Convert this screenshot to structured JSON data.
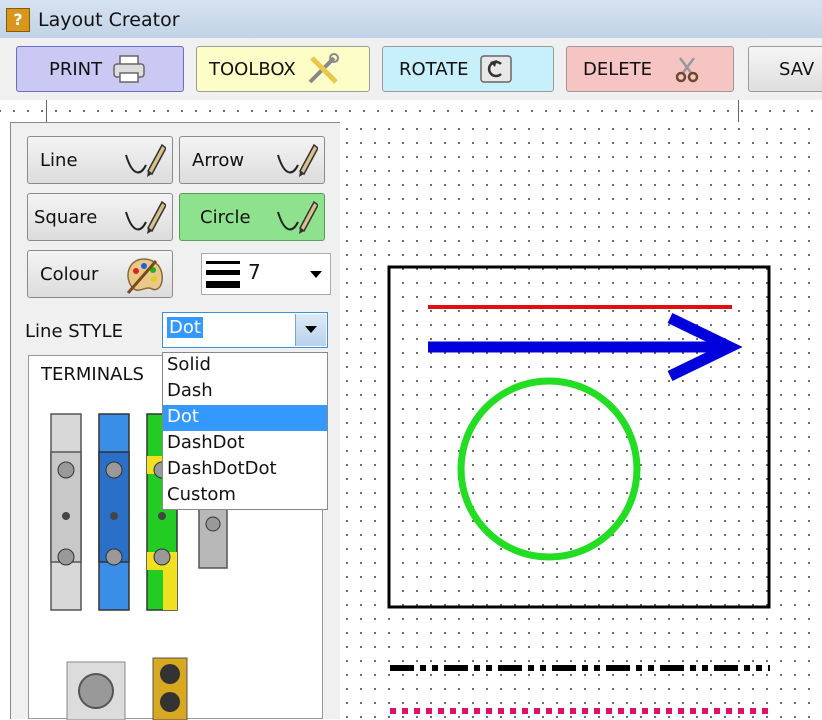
{
  "window": {
    "title": "Layout Creator"
  },
  "toolbar": {
    "print": "PRINT",
    "toolbox": "TOOLBOX",
    "rotate": "ROTATE",
    "delete": "DELETE",
    "save": "SAV"
  },
  "tools": {
    "line": "Line",
    "arrow": "Arrow",
    "square": "Square",
    "circle": "Circle",
    "colour": "Colour",
    "thickness_value": "7"
  },
  "line_style": {
    "label": "Line STYLE",
    "selected": "Dot",
    "options": [
      "Solid",
      "Dash",
      "Dot",
      "DashDot",
      "DashDotDot",
      "Custom"
    ]
  },
  "terminals": {
    "label": "TERMINALS"
  },
  "colors": {
    "print_bg": "#c9c9f3",
    "toolbox_bg": "#fdfdc8",
    "rotate_bg": "#c8f0fb",
    "delete_bg": "#f7c4c4",
    "circle_tool_bg": "#8ee28e",
    "shape_red": "#e01010",
    "shape_blue": "#0000dd",
    "shape_green": "#22dd22",
    "dash_pink": "#e0106a"
  },
  "icons": {
    "print": "printer-icon",
    "toolbox": "tools-icon",
    "rotate": "rotate-icon",
    "delete": "scissors-icon",
    "pencil": "pencil-icon",
    "colour": "palette-icon"
  }
}
